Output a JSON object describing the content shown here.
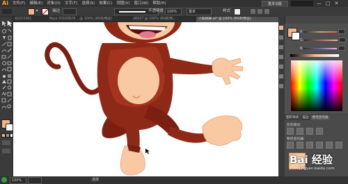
{
  "app": {
    "logo": "Ai"
  },
  "menubar": {
    "items": [
      "文件(F)",
      "编辑(E)",
      "对象(O)",
      "文字(T)",
      "选择(S)",
      "效果(C)",
      "视图(V)",
      "窗口(W)",
      "帮助(H)"
    ],
    "workspace_label": "基本功能",
    "window_buttons": [
      "—",
      "□",
      "✕"
    ]
  },
  "control_bar": {
    "fill_color": "#f5b58c",
    "stroke_color": "#ff0000",
    "stroke_label": "描边",
    "brush_label": "基本",
    "opacity_label": "不透明度",
    "opacity_value": "100%",
    "style_label": "样式"
  },
  "document_tabs": [
    {
      "label": "42153361",
      "active": false
    },
    {
      "label": "Myui 20160829 ...@ 100% (RGB/预览)",
      "active": false
    },
    {
      "label": "26027 @ 100% (RGB/预...",
      "active": false
    },
    {
      "label": "小猴跳舞.ai* @ 100% (RGB/预览)",
      "active": true
    }
  ],
  "tools": {
    "fill_swatch_color": "#f5b58c",
    "stroke_swatch_color": "#ffffff"
  },
  "color_panel": {
    "sliders": [
      {
        "label": "R",
        "color": "#c8a07a"
      },
      {
        "label": "G",
        "color": "#b06a6a"
      },
      {
        "label": "B",
        "color": "#6f6f9a"
      }
    ],
    "current_color": "#f5b58c"
  },
  "bottom_panel": {
    "tabs": [
      {
        "label": "图形样式",
        "active": false
      },
      {
        "label": "描边",
        "active": false
      },
      {
        "label": "路径查找器",
        "active": true
      }
    ],
    "shape_modes_label": "形状模式:",
    "pathfinder_label": "路径查找器:"
  },
  "status_bar": {
    "zoom": "100%",
    "tool_name": "选择"
  },
  "watermark": {
    "text": "Bai 经验",
    "url": "jingyan.baidu.com"
  },
  "colors": {
    "fur_dark": "#7a1f12",
    "fur_mid": "#a5341f",
    "skin": "#f8c9a3",
    "skin_shadow": "#eea77d"
  }
}
